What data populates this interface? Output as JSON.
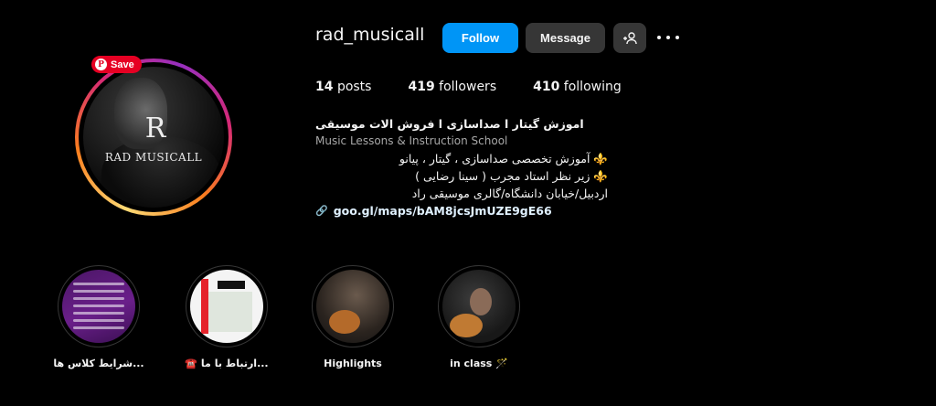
{
  "profile": {
    "username": "rad_musicall",
    "avatar_brand_text": "RAD MUSICALL",
    "avatar_logo": "R"
  },
  "save_overlay": {
    "label": "Save",
    "icon": "pinterest-icon"
  },
  "actions": {
    "follow_label": "Follow",
    "message_label": "Message",
    "add_user_icon": "+👤",
    "more_icon": "more-options-icon"
  },
  "stats": {
    "posts_count": "14",
    "posts_label": "posts",
    "followers_count": "419",
    "followers_label": "followers",
    "following_count": "410",
    "following_label": "following"
  },
  "bio": {
    "name": "اموزش گیتار ا صداسازی ا فروش الات موسیقی",
    "category": "Music Lessons & Instruction School",
    "line1": "⚜️ آموزش تخصصی صداسازی ، گیتار ، پیانو",
    "line2": "⚜️ زیر نظر استاد مجرب ( سینا رضایی )",
    "line3": "اردبیل/خیابان دانشگاه/گالری موسیقی راد",
    "link": "goo.gl/maps/bAM8jcsJmUZE9gE66"
  },
  "highlights": [
    {
      "label": "شرایط کلاس ها..."
    },
    {
      "label": "☎️ ارتباط با ما..."
    },
    {
      "label": "Highlights"
    },
    {
      "label": "in class 🪄"
    }
  ],
  "colors": {
    "background": "#000000",
    "follow_button": "#0095f6",
    "secondary_button": "#363636",
    "save_red": "#e60023"
  }
}
